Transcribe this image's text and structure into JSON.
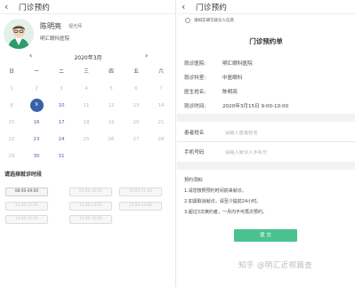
{
  "left": {
    "back_icon": "‹",
    "title": "门诊预约",
    "doctor": {
      "name": "陈明亮",
      "title": "视光师",
      "hospital": "明汇眼科医院",
      "avatar_icon": "doctor-avatar-icon"
    },
    "calendar": {
      "prev": "‹",
      "next": "›",
      "month": "2020年3月",
      "weekdays": [
        "日",
        "一",
        "二",
        "三",
        "四",
        "五",
        "六"
      ],
      "selected_day": "9",
      "available_days": [
        "9",
        "16",
        "23",
        "30",
        "31",
        "17",
        "24",
        "10"
      ],
      "weeks": [
        [
          "1",
          "2",
          "3",
          "4",
          "5",
          "6",
          "7"
        ],
        [
          "8",
          "9",
          "10",
          "11",
          "12",
          "13",
          "14"
        ],
        [
          "15",
          "16",
          "17",
          "18",
          "19",
          "20",
          "21"
        ],
        [
          "22",
          "23",
          "24",
          "25",
          "26",
          "27",
          "28"
        ],
        [
          "29",
          "30",
          "31",
          "",
          "",
          "",
          ""
        ]
      ]
    },
    "slot_title": "请选择就诊时段",
    "slots": [
      "08:00-09:00",
      "09:00-10:00",
      "10:00-11:00",
      "11:00-12:00",
      "12:00-13:00",
      "13:00-14:00",
      "14:00-15:00",
      "15:00-16:00"
    ]
  },
  "right": {
    "title": "门诊预约",
    "notice": "请如实填写就诊人信息",
    "form_title": "门诊预约单",
    "info": [
      {
        "label": "就诊医院:",
        "value": "明汇眼科医院"
      },
      {
        "label": "就诊科室:",
        "value": "中医眼科"
      },
      {
        "label": "医生姓名:",
        "value": "陈明亮"
      },
      {
        "label": "就诊时间:",
        "value": "2020年3月15日  9:00-10:00"
      }
    ],
    "patient_name_label": "患者姓名",
    "patient_name_placeholder": "请输入患者姓名",
    "phone_label": "手机号码",
    "phone_placeholder": "请输入就诊人手机号",
    "tips": [
      "预约须知:",
      "1.请您按照预约时间前来就诊。",
      "2.如需取消就诊，请至少提前24小时。",
      "3.超过3次爽约者，一月内不可再次预约。"
    ],
    "submit": "提 交"
  },
  "watermark": "知乎 @明汇近视篇查",
  "colors": {
    "primary": "#3562a8",
    "submit": "#49c290",
    "available_day": "#3d6aa8",
    "disabled": "#bbbbbb"
  }
}
